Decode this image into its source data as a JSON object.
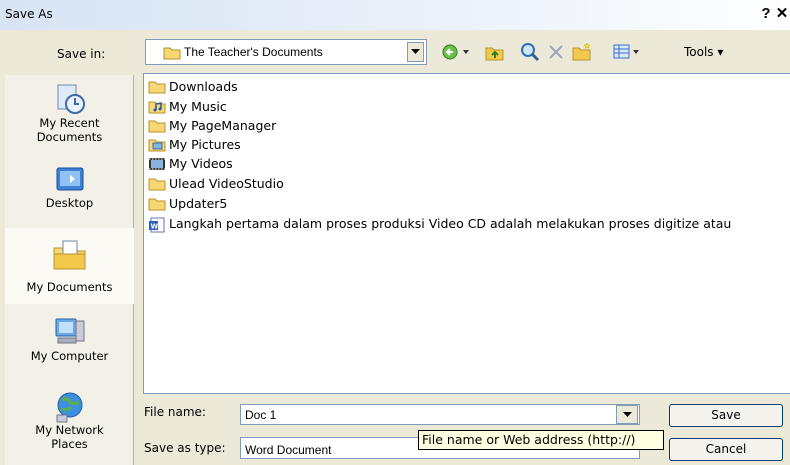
{
  "window": {
    "title": "Save As",
    "help_button": "?",
    "close_button": "✕"
  },
  "toolbar": {
    "save_in_label": "Save in:",
    "save_in_value": "The Teacher's Documents",
    "tools_label": "Tools",
    "icons": [
      "back-icon",
      "up-folder-icon",
      "search-web-icon",
      "delete-icon",
      "new-folder-icon",
      "views-icon"
    ]
  },
  "places": [
    {
      "label_lines": [
        "My Recent",
        "Documents"
      ],
      "icon": "recent-documents-icon"
    },
    {
      "label_lines": [
        "Desktop"
      ],
      "icon": "desktop-icon"
    },
    {
      "label_lines": [
        "My Documents"
      ],
      "icon": "my-documents-icon",
      "selected": true
    },
    {
      "label_lines": [
        "My Computer"
      ],
      "icon": "my-computer-icon"
    },
    {
      "label_lines": [
        "My Network",
        "Places"
      ],
      "icon": "network-places-icon"
    }
  ],
  "files": [
    {
      "name": "Downloads",
      "icon": "folder-icon"
    },
    {
      "name": "My Music",
      "icon": "music-folder-icon"
    },
    {
      "name": "My PageManager",
      "icon": "folder-icon"
    },
    {
      "name": "My Pictures",
      "icon": "pictures-folder-icon"
    },
    {
      "name": "My Videos",
      "icon": "videos-folder-icon"
    },
    {
      "name": "Ulead VideoStudio",
      "icon": "folder-icon"
    },
    {
      "name": "Updater5",
      "icon": "folder-icon"
    },
    {
      "name": "Langkah pertama dalam proses produksi Video CD adalah melakukan proses digitize atau",
      "icon": "word-document-icon"
    }
  ],
  "form": {
    "file_name_label": "File name:",
    "file_name_value": "Doc 1",
    "save_as_type_label": "Save as type:",
    "save_as_type_value": "Word Document",
    "tooltip": "File name or Web address (http://)"
  },
  "buttons": {
    "save": "Save",
    "cancel": "Cancel"
  },
  "colors": {
    "dialog_bg": "#ece9d8",
    "title_gradient_start": "#d7e4f4",
    "border_blue": "#7f9db9",
    "tooltip_bg": "#ffffe1"
  }
}
